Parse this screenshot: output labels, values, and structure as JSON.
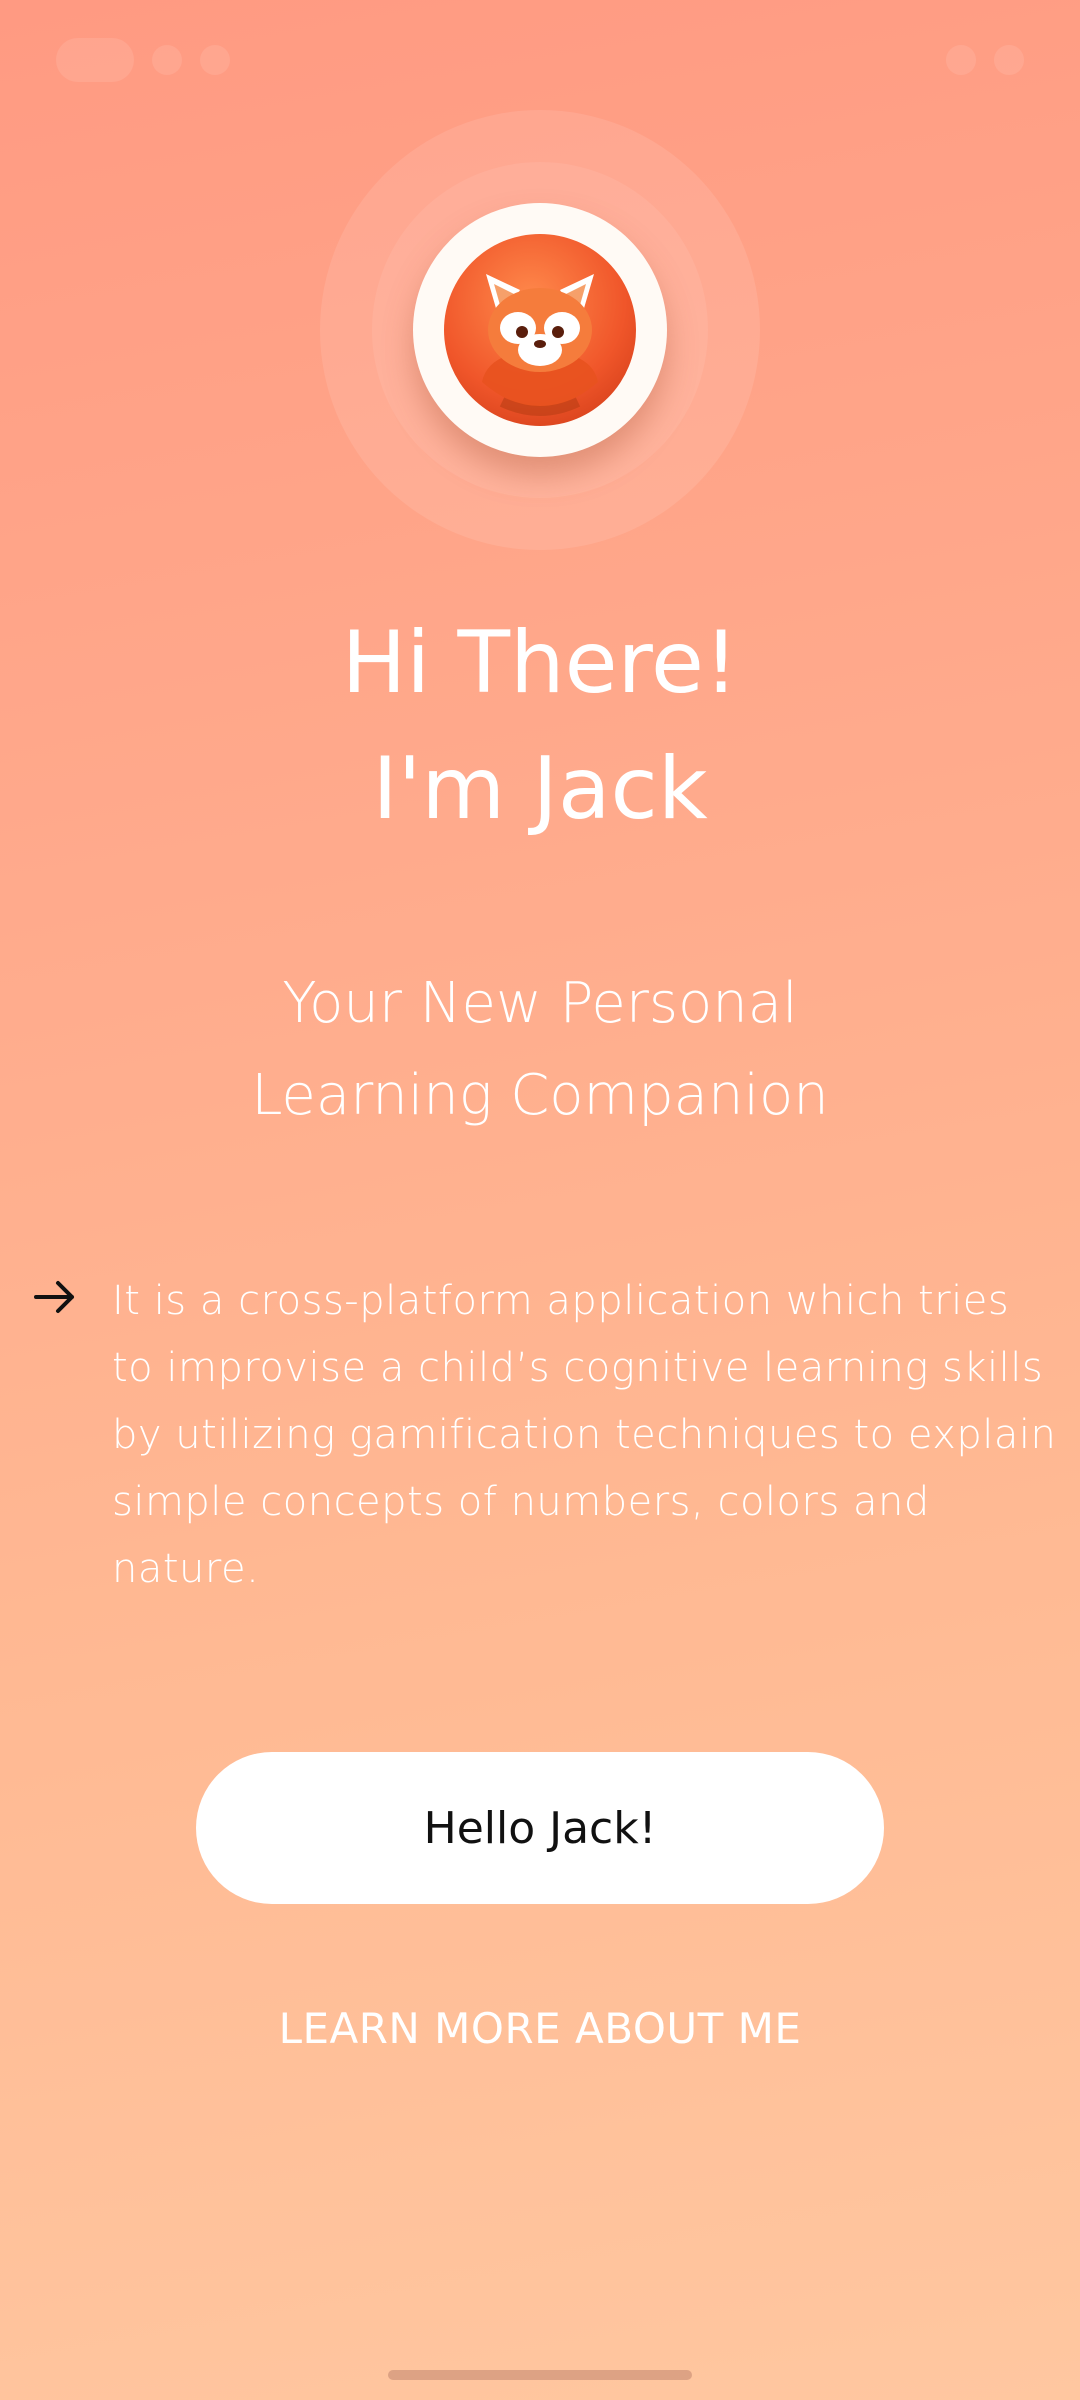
{
  "greeting": {
    "line1": "Hi There!",
    "line2": "I'm Jack"
  },
  "subtitle": {
    "line1": "Your New Personal",
    "line2": "Learning Companion"
  },
  "description": {
    "icon": "arrow-right-icon",
    "text": "It is a cross-platform application which tries to improvise a child’s cognitive learning skills by utilizing gamification techniques to explain simple concepts of numbers, colors and nature."
  },
  "actions": {
    "primary_label": "Hello Jack!",
    "secondary_label": "LEARN MORE ABOUT ME"
  },
  "avatar": {
    "icon": "red-panda-icon"
  },
  "colors": {
    "gradient_top": "#ff9a82",
    "gradient_bottom": "#ffc7a0",
    "button_background": "#ffffff",
    "button_text": "#111111",
    "text": "#ffffff"
  }
}
